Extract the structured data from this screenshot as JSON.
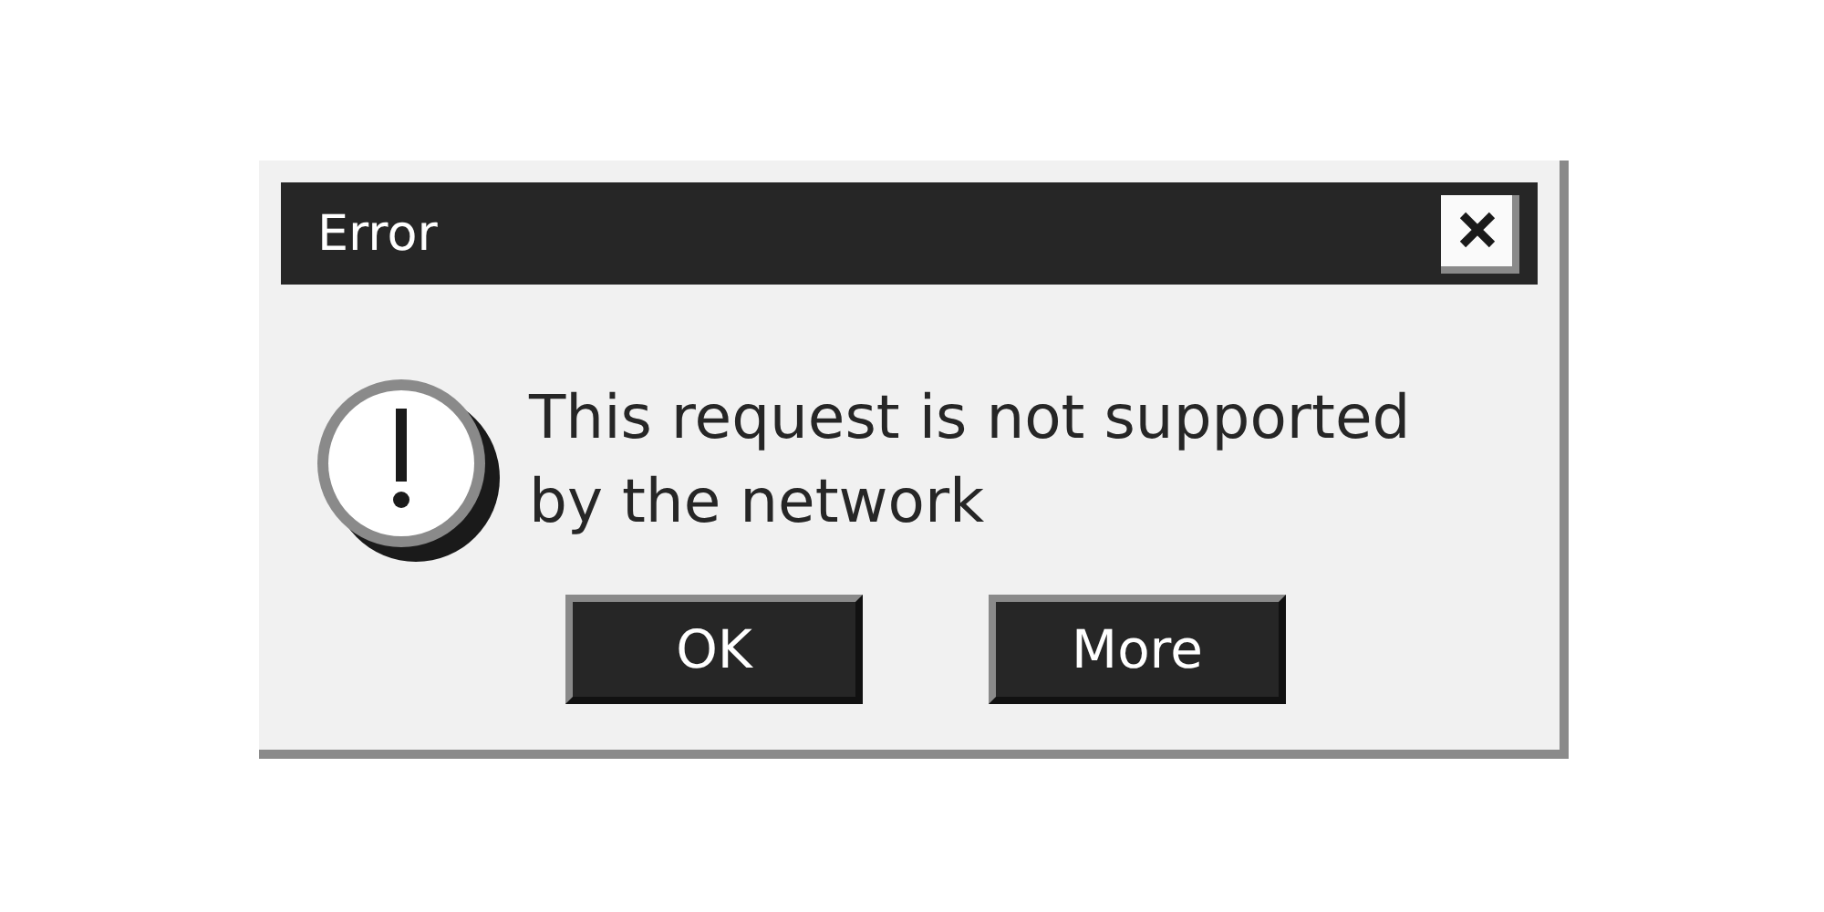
{
  "window": {
    "title": "Error"
  },
  "message": {
    "lines": [
      "This request is not supported",
      "by the network"
    ]
  },
  "buttons": [
    {
      "label": "OK"
    },
    {
      "label": "More"
    }
  ]
}
